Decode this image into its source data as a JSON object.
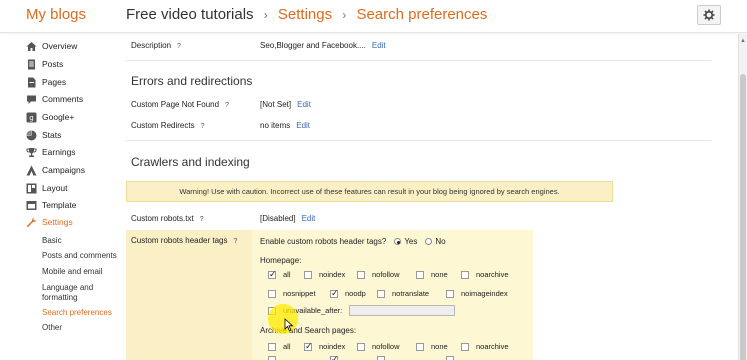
{
  "header": {
    "brand": "My blogs",
    "blog_name": "Free video tutorials",
    "sep1": "›",
    "settings": "Settings",
    "sep2": "›",
    "page": "Search preferences"
  },
  "sidebar": {
    "items": [
      {
        "label": "Overview",
        "icon": "home-icon"
      },
      {
        "label": "Posts",
        "icon": "posts-icon"
      },
      {
        "label": "Pages",
        "icon": "pages-icon"
      },
      {
        "label": "Comments",
        "icon": "comments-icon"
      },
      {
        "label": "Google+",
        "icon": "google-plus-icon"
      },
      {
        "label": "Stats",
        "icon": "stats-icon"
      },
      {
        "label": "Earnings",
        "icon": "trophy-icon"
      },
      {
        "label": "Campaigns",
        "icon": "campaigns-icon"
      },
      {
        "label": "Layout",
        "icon": "layout-icon"
      },
      {
        "label": "Template",
        "icon": "template-icon"
      },
      {
        "label": "Settings",
        "icon": "wrench-icon"
      }
    ],
    "sub_items": [
      {
        "label": "Basic"
      },
      {
        "label": "Posts and comments"
      },
      {
        "label": "Mobile and email"
      },
      {
        "label": "Language and formatting"
      },
      {
        "label": "Search preferences"
      },
      {
        "label": "Other"
      }
    ]
  },
  "main": {
    "description": {
      "label": "Description",
      "help": "?",
      "value": "Seo,Blogger and Facebook....",
      "edit": "Edit"
    },
    "errors_title": "Errors and redirections",
    "not_found": {
      "label": "Custom Page Not Found",
      "help": "?",
      "value": "[Not Set]",
      "edit": "Edit"
    },
    "redirects": {
      "label": "Custom Redirects",
      "help": "?",
      "value": "no items",
      "edit": "Edit"
    },
    "crawlers_title": "Crawlers and indexing",
    "warning": "Warning! Use with caution. Incorrect use of these features can result in your blog being ignored by search engines.",
    "robots_txt": {
      "label": "Custom robots.txt",
      "help": "?",
      "value": "[Disabled]",
      "edit": "Edit"
    },
    "robots_header": {
      "label": "Custom robots header tags",
      "help": "?",
      "enable_question": "Enable custom robots header tags?",
      "yes": "Yes",
      "no": "No",
      "homepage_label": "Homepage:",
      "homepage_row1": [
        {
          "label": "all",
          "checked": true
        },
        {
          "label": "noindex",
          "checked": false
        },
        {
          "label": "nofollow",
          "checked": false
        },
        {
          "label": "none",
          "checked": false
        },
        {
          "label": "noarchive",
          "checked": false
        }
      ],
      "homepage_row2": [
        {
          "label": "nosnippet",
          "checked": false
        },
        {
          "label": "noodp",
          "checked": true
        },
        {
          "label": "notranslate",
          "checked": false
        },
        {
          "label": "noimageindex",
          "checked": false
        }
      ],
      "unavailable_after": "unavailable_after:",
      "archive_label": "Archive and Search pages:",
      "archive_row1": [
        {
          "label": "all",
          "checked": false
        },
        {
          "label": "noindex",
          "checked": true
        },
        {
          "label": "nofollow",
          "checked": false
        },
        {
          "label": "none",
          "checked": false
        },
        {
          "label": "noarchive",
          "checked": false
        }
      ]
    }
  },
  "colors": {
    "accent": "#dd6b1e",
    "link": "#3a66b8",
    "warning_bg": "#fbf0c5"
  }
}
